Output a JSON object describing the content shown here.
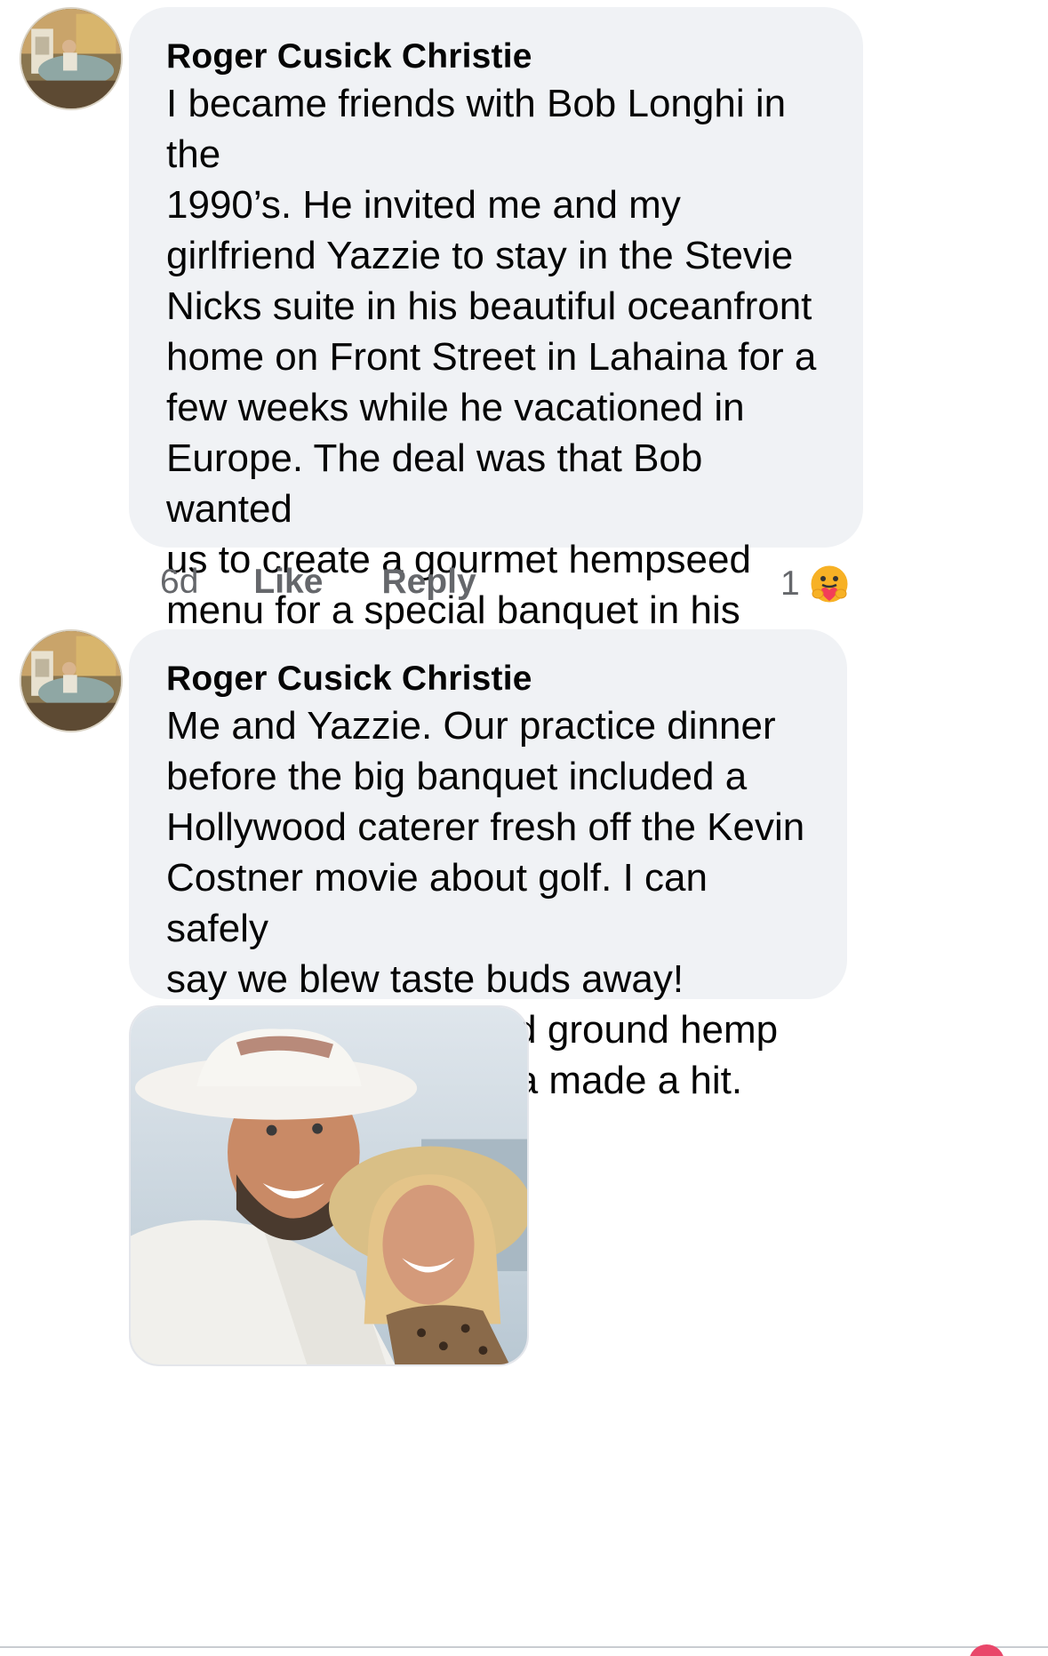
{
  "comments": [
    {
      "author": "Roger Cusick Christie",
      "text": "I became friends with Bob Longhi in the\n1990’s.  He invited me and my\ngirlfriend Yazzie to stay in the Stevie\nNicks suite in his beautiful oceanfront\nhome on Front Street in Lahaina for a\nfew weeks while he vacationed in\nEurope.  The deal was that Bob wanted\nus to create a gourmet hempseed\nmenu for a special banquet in his\nfamous restaurant, Longhi’s. We did; it\nrocked.  R.I.P., Bob",
      "time": "6d",
      "like_label": "Like",
      "reply_label": "Reply",
      "reaction_count": "1",
      "reaction_icon": "care-emoji-icon"
    },
    {
      "author": "Roger Cusick Christie",
      "text": "Me and Yazzie.  Our practice dinner\nbefore the big banquet included a\nHollywood caterer fresh off the Kevin\nCostner movie about golf.  I can safely\nsay we blew taste buds away!\nWashed, roasted and ground hemp\nbirdseeds from China made a hit.",
      "attachment": "photo"
    }
  ],
  "colors": {
    "bubble": "#f0f2f5",
    "text": "#050505",
    "meta": "#65676b"
  }
}
